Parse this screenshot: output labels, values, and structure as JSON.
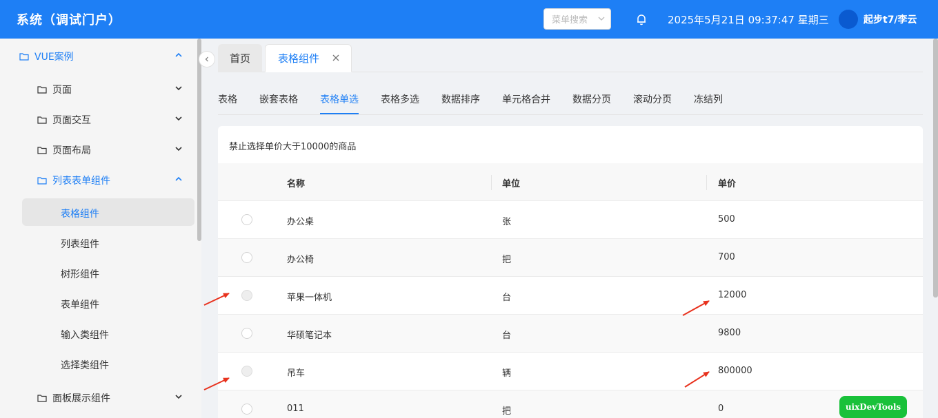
{
  "header": {
    "title": "系统（调试门户）",
    "search_placeholder": "菜单搜索",
    "datetime": "2025年5月21日 09:37:47 星期三",
    "user": "起步t7/李云",
    "colors": {
      "bar": "#1e7ff5",
      "avatar": "#0a5ad0"
    }
  },
  "sidebar": {
    "root": "VUE案例",
    "groups": [
      "页面",
      "页面交互",
      "页面布局",
      "列表表单组件"
    ],
    "children": [
      "表格组件",
      "列表组件",
      "树形组件",
      "表单组件",
      "输入类组件",
      "选择类组件"
    ],
    "bottom_group": "面板展示组件"
  },
  "tabs": {
    "home": "首页",
    "active": "表格组件"
  },
  "subnav": [
    "表格",
    "嵌套表格",
    "表格单选",
    "表格多选",
    "数据排序",
    "单元格合并",
    "数据分页",
    "滚动分页",
    "冻结列"
  ],
  "table": {
    "hint": "禁止选择单价大于10000的商品",
    "headers": {
      "name": "名称",
      "unit": "单位",
      "price": "单价"
    },
    "rows": [
      {
        "name": "办公桌",
        "unit": "张",
        "price": "500",
        "disabled": false
      },
      {
        "name": "办公椅",
        "unit": "把",
        "price": "700",
        "disabled": false
      },
      {
        "name": "苹果一体机",
        "unit": "台",
        "price": "12000",
        "disabled": true
      },
      {
        "name": "华硕笔记本",
        "unit": "台",
        "price": "9800",
        "disabled": false
      },
      {
        "name": "吊车",
        "unit": "辆",
        "price": "800000",
        "disabled": true
      },
      {
        "name": "011",
        "unit": "把",
        "price": "0",
        "disabled": false
      }
    ]
  },
  "devtools_label": "uixDevTools",
  "accent_color": "#1e7ff5",
  "arrow_color": "#e8321e"
}
